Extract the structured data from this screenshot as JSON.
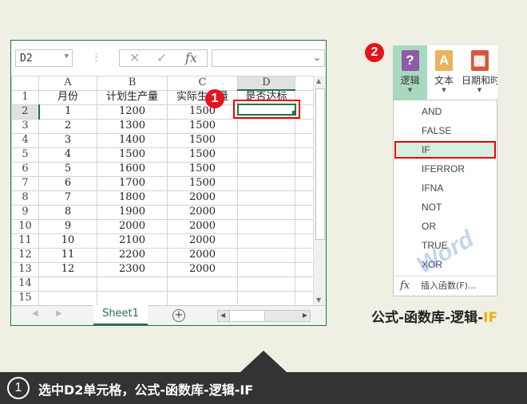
{
  "excel": {
    "name_box": "D2",
    "formula_icons": {
      "cancel": "✕",
      "enter": "✓",
      "fx": "fx"
    },
    "columns": [
      "A",
      "B",
      "C",
      "D"
    ],
    "rows": [
      {
        "n": "1",
        "a": "月份",
        "b": "计划生产量",
        "c": "实际生产量",
        "d": "是否达标"
      },
      {
        "n": "2",
        "a": "1",
        "b": "1200",
        "c": "1500",
        "d": ""
      },
      {
        "n": "3",
        "a": "2",
        "b": "1300",
        "c": "1500",
        "d": ""
      },
      {
        "n": "4",
        "a": "3",
        "b": "1400",
        "c": "1500",
        "d": ""
      },
      {
        "n": "5",
        "a": "4",
        "b": "1500",
        "c": "1500",
        "d": ""
      },
      {
        "n": "6",
        "a": "5",
        "b": "1600",
        "c": "1500",
        "d": ""
      },
      {
        "n": "7",
        "a": "6",
        "b": "1700",
        "c": "1500",
        "d": ""
      },
      {
        "n": "8",
        "a": "7",
        "b": "1800",
        "c": "2000",
        "d": ""
      },
      {
        "n": "9",
        "a": "8",
        "b": "1900",
        "c": "2000",
        "d": ""
      },
      {
        "n": "10",
        "a": "9",
        "b": "2000",
        "c": "2000",
        "d": ""
      },
      {
        "n": "11",
        "a": "10",
        "b": "2100",
        "c": "2000",
        "d": ""
      },
      {
        "n": "12",
        "a": "11",
        "b": "2200",
        "c": "2000",
        "d": ""
      },
      {
        "n": "13",
        "a": "12",
        "b": "2300",
        "c": "2000",
        "d": ""
      },
      {
        "n": "14",
        "a": "",
        "b": "",
        "c": "",
        "d": ""
      },
      {
        "n": "15",
        "a": "",
        "b": "",
        "c": "",
        "d": ""
      }
    ],
    "sheet_tab": "Sheet1",
    "add_sheet": "+"
  },
  "badges": {
    "one": "1",
    "two": "2"
  },
  "ribbon": {
    "buttons": [
      {
        "label": "逻辑",
        "icon": "?",
        "color": "#8e5ba6"
      },
      {
        "label": "文本",
        "icon": "A",
        "color": "#e6b45a"
      },
      {
        "label": "日期和时",
        "icon": "▦",
        "color": "#d9553b"
      }
    ]
  },
  "menu": {
    "items": [
      "AND",
      "FALSE",
      "IF",
      "IFERROR",
      "IFNA",
      "NOT",
      "OR",
      "TRUE",
      "XOR"
    ],
    "selected": "IF",
    "insert_function": "插入函数(F)...",
    "insert_icon": "fx"
  },
  "caption": {
    "prefix": "公式-函数库-逻辑-",
    "highlight": "IF"
  },
  "footer": {
    "step": "1",
    "text": "选中D2单元格，公式-函数库-逻辑-IF"
  },
  "watermark": "Word联盟"
}
